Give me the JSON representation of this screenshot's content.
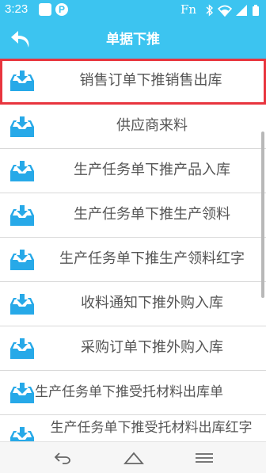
{
  "status_bar": {
    "time": "3:23",
    "app_icon_letter": "P",
    "fn_label": "Fn",
    "icons": [
      "bluetooth-icon",
      "wifi-icon",
      "signal-icon",
      "battery-icon"
    ]
  },
  "header": {
    "title": "单据下推",
    "back_icon": "back-arrow-icon"
  },
  "list": {
    "item_icon": "inbox-download-icon",
    "items": [
      {
        "label": "销售订单下推销售出库",
        "selected": true
      },
      {
        "label": "供应商来料"
      },
      {
        "label": "生产任务单下推产品入库"
      },
      {
        "label": "生产任务单下推生产领料"
      },
      {
        "label": "生产任务单下推生产领料红字"
      },
      {
        "label": "收料通知下推外购入库"
      },
      {
        "label": "采购订单下推外购入库"
      },
      {
        "label": "生产任务单下推受托材料出库单"
      },
      {
        "label": "生产任务单下推受托材料出库红字"
      }
    ]
  },
  "nav_bar": {
    "back": "nav-back-icon",
    "home": "nav-home-icon",
    "menu": "nav-menu-icon"
  },
  "colors": {
    "primary": "#3cc4f0",
    "selection_border": "#e8353e",
    "text": "#555555"
  }
}
